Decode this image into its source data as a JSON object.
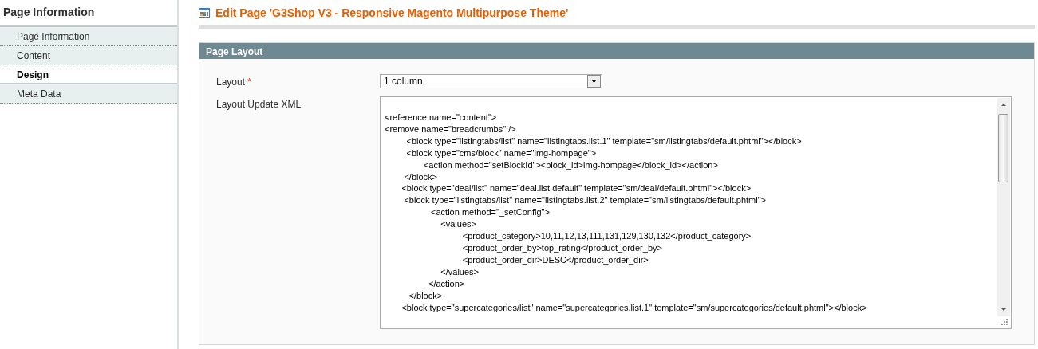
{
  "sidebar": {
    "title": "Page Information",
    "items": [
      {
        "label": "Page Information",
        "selected": false
      },
      {
        "label": "Content",
        "selected": false
      },
      {
        "label": "Design",
        "selected": true
      },
      {
        "label": "Meta Data",
        "selected": false
      }
    ]
  },
  "page_title": "Edit Page 'G3Shop V3 - Responsive Magento Multipurpose Theme'",
  "section": {
    "title": "Page Layout",
    "fields": [
      {
        "kind": "select",
        "label": "Layout",
        "required_mark": "*",
        "value": "1 column"
      },
      {
        "kind": "textarea",
        "label": "Layout Update XML",
        "lines": [
          "<reference name=\"content\">",
          "<remove name=\"breadcrumbs\" />",
          "         <block type=\"listingtabs/list\" name=\"listingtabs.list.1\" template=\"sm/listingtabs/default.phtml\"></block>",
          "         <block type=\"cms/block\" name=\"img-hompage\">",
          "                <action method=\"setBlockId\"><block_id>img-hompage</block_id></action>",
          "        </block>",
          "       <block type=\"deal/list\" name=\"deal.list.default\" template=\"sm/deal/default.phtml\"></block>",
          "        <block type=\"listingtabs/list\" name=\"listingtabs.list.2\" template=\"sm/listingtabs/default.phtml\">",
          "                   <action method=\"_setConfig\">",
          "                       <values>",
          "                                <product_category>10,11,12,13,111,131,129,130,132</product_category>",
          "                                <product_order_by>top_rating</product_order_by>",
          "                                <product_order_dir>DESC</product_order_dir>",
          "                       </values>",
          "                  </action>",
          "          </block>",
          "       <block type=\"supercategories/list\" name=\"supercategories.list.1\" template=\"sm/supercategories/default.phtml\"></block>"
        ]
      }
    ]
  }
}
